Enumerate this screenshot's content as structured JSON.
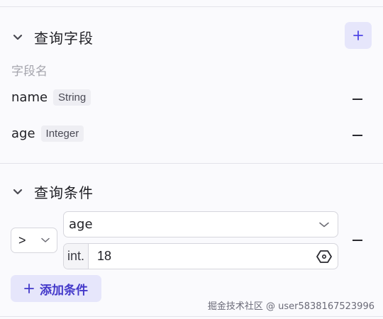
{
  "query_fields": {
    "title": "查询字段",
    "column_label": "字段名",
    "fields": [
      {
        "name": "name",
        "type": "String"
      },
      {
        "name": "age",
        "type": "Integer"
      }
    ]
  },
  "query_conditions": {
    "title": "查询条件",
    "operator": ">",
    "field": "age",
    "value_prefix": "int.",
    "value": "18",
    "add_label": "添加条件"
  },
  "watermark": "掘金技术社区 @ user5838167523996",
  "colors": {
    "accent": "#4338ca",
    "accent_bg": "#e6e6fb",
    "background": "#fafafd"
  }
}
